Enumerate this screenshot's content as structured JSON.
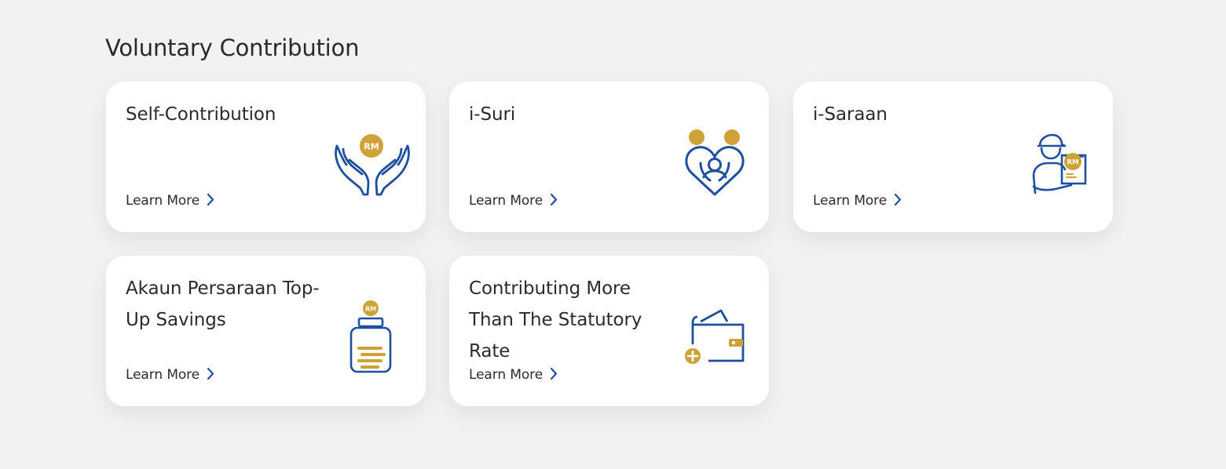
{
  "section": {
    "title": "Voluntary Contribution"
  },
  "cards": [
    {
      "title": "Self-Contribution",
      "link_label": "Learn More",
      "icon": "hands-coin-icon"
    },
    {
      "title": "i-Suri",
      "link_label": "Learn More",
      "icon": "heart-family-icon"
    },
    {
      "title": "i-Saraan",
      "link_label": "Learn More",
      "icon": "worker-receipt-icon"
    },
    {
      "title": "Akaun Persaraan Top-Up Savings",
      "link_label": "Learn More",
      "icon": "coin-jar-icon"
    },
    {
      "title": "Contributing More Than The Statutory Rate",
      "link_label": "Learn More",
      "icon": "wallet-plus-icon"
    }
  ],
  "icon_text": {
    "currency": "RM"
  },
  "colors": {
    "background": "#f2f2f2",
    "card": "#ffffff",
    "icon_blue": "#1f4fa0",
    "icon_gold": "#cfa238",
    "text": "#2b2b2b"
  }
}
